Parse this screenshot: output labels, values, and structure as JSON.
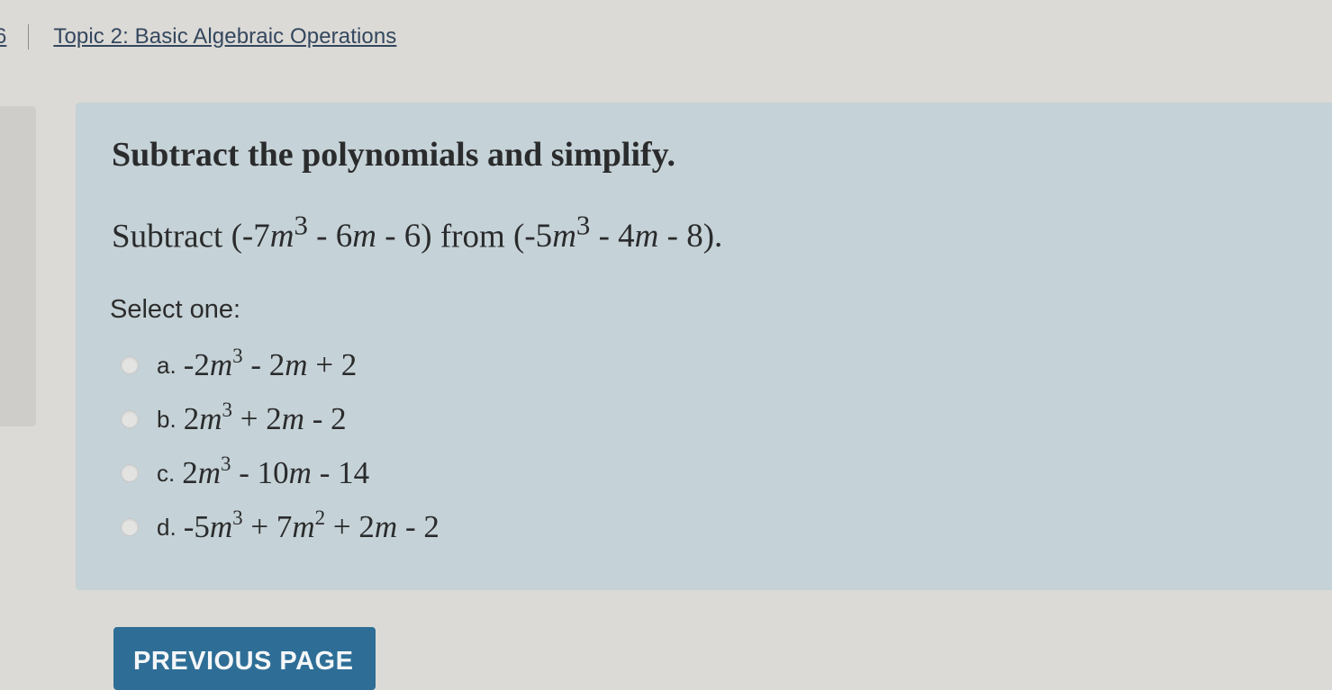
{
  "breadcrumb": {
    "prev_text": "6",
    "topic_link": "Topic 2: Basic Algebraic Operations"
  },
  "question": {
    "title": "Subtract the polynomials and simplify.",
    "prompt": {
      "word": "Subtract",
      "expr1": {
        "open": "(-7",
        "var": "m",
        "exp": "3",
        "mid": " - 6",
        "var2": "m",
        "close": " - 6)"
      },
      "from_word": "from",
      "expr2": {
        "open": "(-5",
        "var": "m",
        "exp": "3",
        "mid": " - 4",
        "var2": "m",
        "close": " - 8)."
      }
    },
    "select_label": "Select one:"
  },
  "options": [
    {
      "letter": "a.",
      "text": "-2m³ - 2m + 2"
    },
    {
      "letter": "b.",
      "text": "2m³ + 2m - 2"
    },
    {
      "letter": "c.",
      "text": "2m³ - 10m - 14"
    },
    {
      "letter": "d.",
      "text": "-5m³ + 7m² + 2m - 2"
    }
  ],
  "math_parts": {
    "a": {
      "p1": "-2",
      "v1": "m",
      "e1": "3",
      "p2": " - 2",
      "v2": "m",
      "p3": " + 2"
    },
    "b": {
      "p1": "2",
      "v1": "m",
      "e1": "3",
      "p2": " + 2",
      "v2": "m",
      "p3": " - 2"
    },
    "c": {
      "p1": "2",
      "v1": "m",
      "e1": "3",
      "p2": " - 10",
      "v2": "m",
      "p3": " - 14"
    },
    "d": {
      "p1": "-5",
      "v1": "m",
      "e1": "3",
      "p2": " + 7",
      "v2": "m",
      "e2": "2",
      "p3": " + 2",
      "v3": "m",
      "p4": " - 2"
    }
  },
  "nav": {
    "previous_label": "PREVIOUS PAGE"
  },
  "colors": {
    "panel_bg": "#c5d2d7",
    "button_bg": "#2e6e96",
    "page_bg": "#dcdad6"
  },
  "icons": {
    "radio": "radio-circle"
  }
}
